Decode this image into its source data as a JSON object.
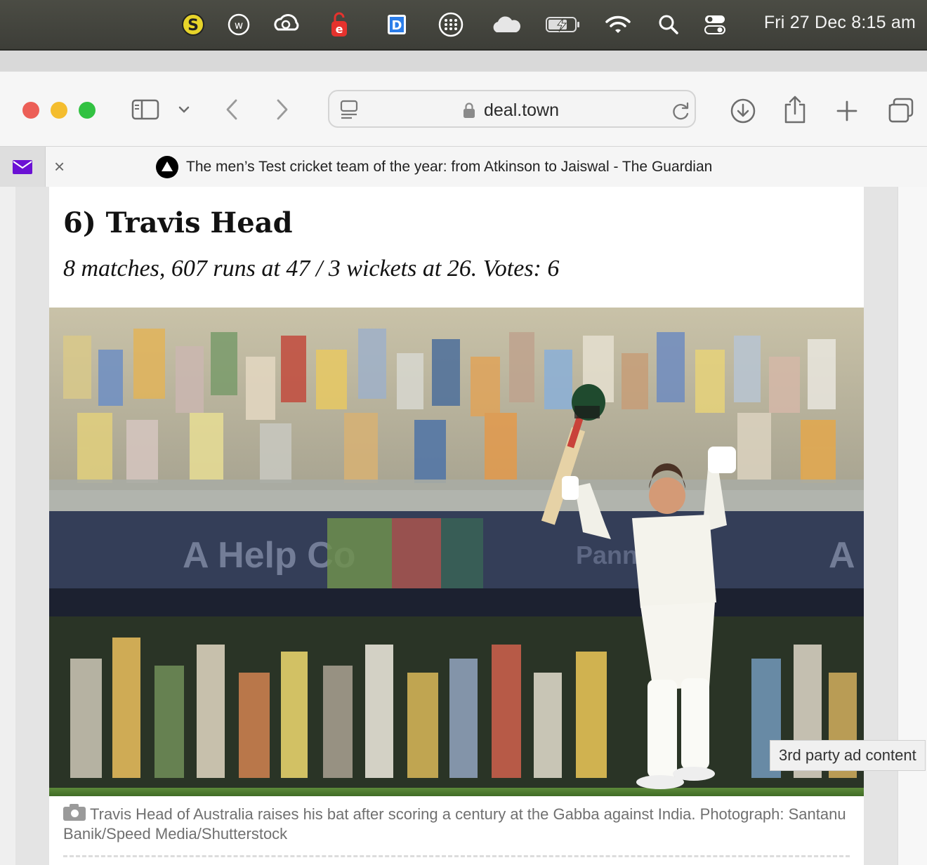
{
  "menubar": {
    "icons": [
      "s-coin-icon",
      "w-circle-icon",
      "creative-cloud-icon",
      "lock-e-icon",
      "d-app-icon",
      "grid-dots-icon",
      "cloud-icon",
      "battery-charging-icon",
      "wifi-icon",
      "search-icon",
      "control-center-icon"
    ],
    "clock": "Fri 27 Dec  8:15 am"
  },
  "toolbar": {
    "url": "deal.town"
  },
  "tabs": {
    "active_title": "The men’s Test cricket team of the year: from Atkinson to Jaiswal - The Guardian",
    "close_symbol": "×"
  },
  "article": {
    "heading": "6) Travis Head",
    "subheading": "8 matches, 607 runs at 47 / 3 wickets at 26. Votes: 6",
    "caption": "Travis Head of Australia raises his bat after scoring a century at the Gabba against India. Photograph: Santanu Banik/Speed Media/Shutterstock"
  },
  "ad_label": "3rd party ad content",
  "colors": {
    "close": "#ec5f57",
    "minimize": "#f4bd2f",
    "zoom": "#32c242"
  }
}
